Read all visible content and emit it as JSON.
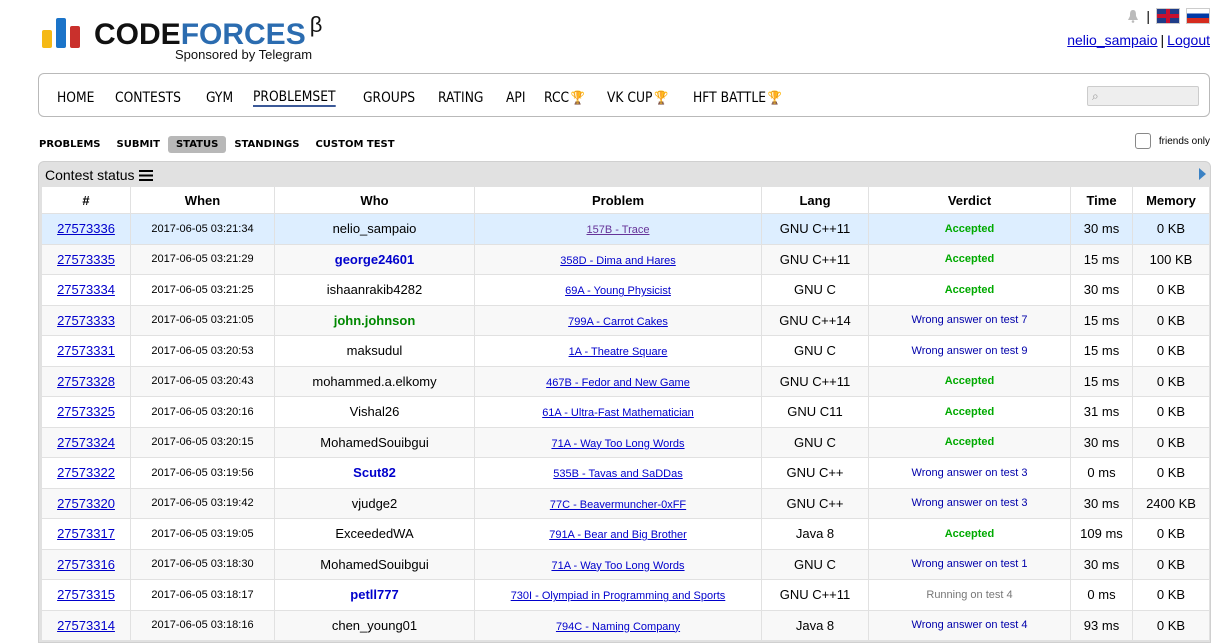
{
  "header": {
    "logo_part1": "CODE",
    "logo_part2": "FORCES",
    "logo_beta": "β",
    "logo_sub": "Sponsored by Telegram",
    "user": "nelio_sampaio",
    "logout": "Logout",
    "separator": "|"
  },
  "menu": [
    {
      "label": "HOME"
    },
    {
      "label": "CONTESTS"
    },
    {
      "label": "GYM"
    },
    {
      "label": "PROBLEMSET",
      "active": true
    },
    {
      "label": "GROUPS"
    },
    {
      "label": "RATING"
    },
    {
      "label": "API"
    },
    {
      "label": "RCC",
      "trophy": true
    },
    {
      "label": "VK CUP",
      "trophy": true
    },
    {
      "label": "HFT BATTLE",
      "trophy": true
    }
  ],
  "submenu": [
    {
      "label": "PROBLEMS"
    },
    {
      "label": "SUBMIT"
    },
    {
      "label": "STATUS",
      "active": true
    },
    {
      "label": "STANDINGS"
    },
    {
      "label": "CUSTOM TEST"
    }
  ],
  "friends_label": "friends only",
  "frame_title": "Contest status",
  "columns": [
    "#",
    "When",
    "Who",
    "Problem",
    "Lang",
    "Verdict",
    "Time",
    "Memory"
  ],
  "rows": [
    {
      "id": "27573336",
      "when": "2017-06-05 03:21:34",
      "who": "nelio_sampaio",
      "who_color": "black",
      "problem": "157B - Trace",
      "lang": "GNU C++11",
      "verdict": "Accepted",
      "verdict_type": "ok",
      "time": "30 ms",
      "memory": "0 KB",
      "mine": true
    },
    {
      "id": "27573335",
      "when": "2017-06-05 03:21:29",
      "who": "george24601",
      "who_color": "blue",
      "problem": "358D - Dima and Hares",
      "lang": "GNU C++11",
      "verdict": "Accepted",
      "verdict_type": "ok",
      "time": "15 ms",
      "memory": "100 KB"
    },
    {
      "id": "27573334",
      "when": "2017-06-05 03:21:25",
      "who": "ishaanrakib4282",
      "who_color": "black",
      "problem": "69A - Young Physicist",
      "lang": "GNU C",
      "verdict": "Accepted",
      "verdict_type": "ok",
      "time": "30 ms",
      "memory": "0 KB"
    },
    {
      "id": "27573333",
      "when": "2017-06-05 03:21:05",
      "who": "john.johnson",
      "who_color": "green",
      "problem": "799A - Carrot Cakes",
      "lang": "GNU C++14",
      "verdict": "Wrong answer on test 7",
      "verdict_type": "wa",
      "time": "15 ms",
      "memory": "0 KB"
    },
    {
      "id": "27573331",
      "when": "2017-06-05 03:20:53",
      "who": "maksudul",
      "who_color": "black",
      "problem": "1A - Theatre Square",
      "lang": "GNU C",
      "verdict": "Wrong answer on test 9",
      "verdict_type": "wa",
      "time": "15 ms",
      "memory": "0 KB"
    },
    {
      "id": "27573328",
      "when": "2017-06-05 03:20:43",
      "who": "mohammed.a.elkomy",
      "who_color": "black",
      "problem": "467B - Fedor and New Game",
      "lang": "GNU C++11",
      "verdict": "Accepted",
      "verdict_type": "ok",
      "time": "15 ms",
      "memory": "0 KB"
    },
    {
      "id": "27573325",
      "when": "2017-06-05 03:20:16",
      "who": "Vishal26",
      "who_color": "black",
      "problem": "61A - Ultra-Fast Mathematician",
      "lang": "GNU C11",
      "verdict": "Accepted",
      "verdict_type": "ok",
      "time": "31 ms",
      "memory": "0 KB"
    },
    {
      "id": "27573324",
      "when": "2017-06-05 03:20:15",
      "who": "MohamedSouibgui",
      "who_color": "black",
      "problem": "71A - Way Too Long Words",
      "lang": "GNU C",
      "verdict": "Accepted",
      "verdict_type": "ok",
      "time": "30 ms",
      "memory": "0 KB"
    },
    {
      "id": "27573322",
      "when": "2017-06-05 03:19:56",
      "who": "Scut82",
      "who_color": "blue",
      "problem": "535B - Tavas and SaDDas",
      "lang": "GNU C++",
      "verdict": "Wrong answer on test 3",
      "verdict_type": "wa",
      "time": "0 ms",
      "memory": "0 KB"
    },
    {
      "id": "27573320",
      "when": "2017-06-05 03:19:42",
      "who": "vjudge2",
      "who_color": "black",
      "problem": "77C - Beavermuncher-0xFF",
      "lang": "GNU C++",
      "verdict": "Wrong answer on test 3",
      "verdict_type": "wa",
      "time": "30 ms",
      "memory": "2400 KB"
    },
    {
      "id": "27573317",
      "when": "2017-06-05 03:19:05",
      "who": "ExceededWA",
      "who_color": "black",
      "problem": "791A - Bear and Big Brother",
      "lang": "Java 8",
      "verdict": "Accepted",
      "verdict_type": "ok",
      "time": "109 ms",
      "memory": "0 KB"
    },
    {
      "id": "27573316",
      "when": "2017-06-05 03:18:30",
      "who": "MohamedSouibgui",
      "who_color": "black",
      "problem": "71A - Way Too Long Words",
      "lang": "GNU C",
      "verdict": "Wrong answer on test 1",
      "verdict_type": "wa",
      "time": "30 ms",
      "memory": "0 KB"
    },
    {
      "id": "27573315",
      "when": "2017-06-05 03:18:17",
      "who": "petll777",
      "who_color": "blue",
      "problem": "730I - Olympiad in Programming and Sports",
      "lang": "GNU C++11",
      "verdict": "Running on test 4",
      "verdict_type": "run",
      "time": "0 ms",
      "memory": "0 KB"
    },
    {
      "id": "27573314",
      "when": "2017-06-05 03:18:16",
      "who": "chen_young01",
      "who_color": "black",
      "problem": "794C - Naming Company",
      "lang": "Java 8",
      "verdict": "Wrong answer on test 4",
      "verdict_type": "wa",
      "time": "93 ms",
      "memory": "0 KB"
    }
  ]
}
